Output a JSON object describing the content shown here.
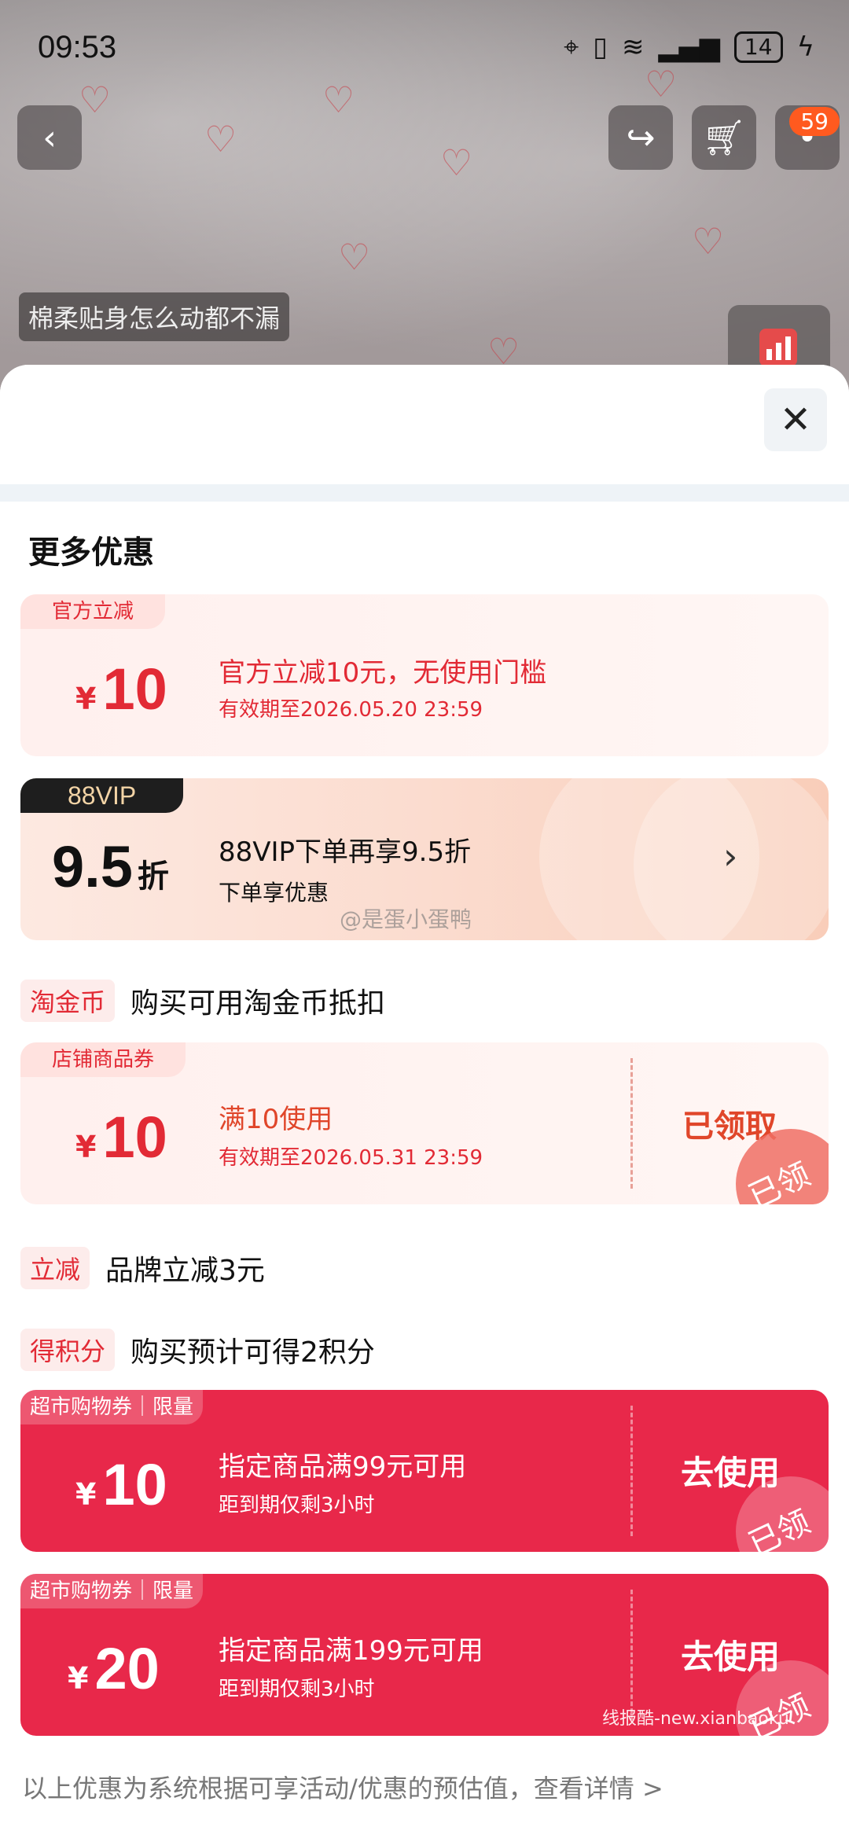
{
  "status_bar": {
    "time": "09:53",
    "battery": "14"
  },
  "header": {
    "cart_badge": "59",
    "caption": "棉柔贴身怎么动都不漏"
  },
  "sheet": {
    "title": "更多优惠"
  },
  "coupons": {
    "official": {
      "tag": "官方立减",
      "currency": "¥",
      "amount": "10",
      "title": "官方立减10元，无使用门槛",
      "validity": "有效期至2026.05.20 23:59"
    },
    "vip": {
      "tag": "88VIP",
      "discount": "9.5",
      "unit": "折",
      "title": "88VIP下单再享9.5折",
      "subtitle": "下单享优惠"
    },
    "store": {
      "tag": "店铺商品券",
      "currency": "¥",
      "amount": "10",
      "title": "满10使用",
      "validity": "有效期至2026.05.31 23:59",
      "status": "已领取",
      "stamp": "已领"
    },
    "market1": {
      "tag": "超市购物券｜限量",
      "currency": "¥",
      "amount": "10",
      "title": "指定商品满99元可用",
      "subtitle": "距到期仅剩3小时",
      "action": "去使用",
      "stamp": "已领"
    },
    "market2": {
      "tag": "超市购物券｜限量",
      "currency": "¥",
      "amount": "20",
      "title": "指定商品满199元可用",
      "subtitle": "距到期仅剩3小时",
      "action": "去使用",
      "stamp": "已领"
    }
  },
  "info_rows": {
    "taojinbi": {
      "badge": "淘金币",
      "text": "购买可用淘金币抵扣"
    },
    "lijian": {
      "badge": "立减",
      "text": "品牌立减3元"
    },
    "points": {
      "badge": "得积分",
      "text": "购买预计可得2积分"
    }
  },
  "watermarks": {
    "weibo": "@是蛋小蛋鸭",
    "site": "线报酷-new.xianbaoku"
  },
  "footer": {
    "note": "以上优惠为系统根据可享活动/优惠的预估值，查看详情 >"
  },
  "colors": {
    "brand_red": "#e22a35",
    "coupon_red": "#e8284a",
    "vip_black": "#1e1e1e"
  }
}
